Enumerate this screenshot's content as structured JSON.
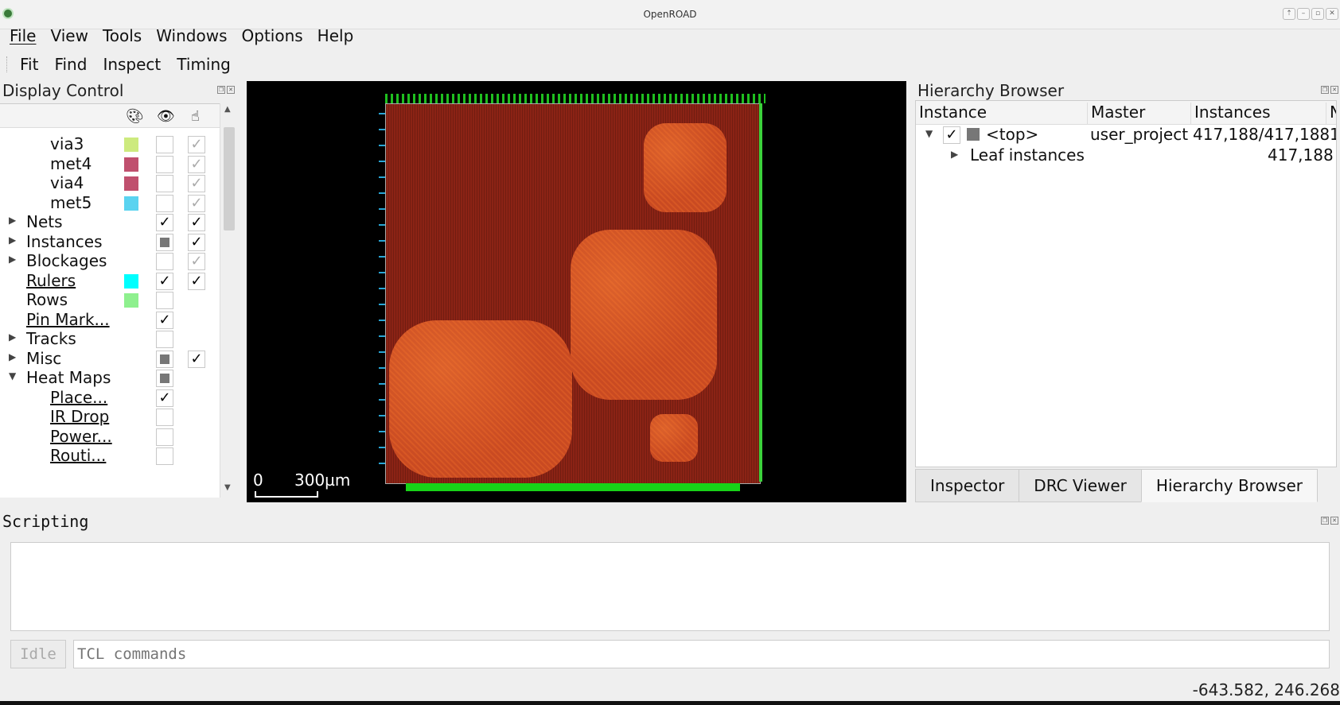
{
  "window": {
    "title": "OpenROAD"
  },
  "menu": [
    {
      "label": "File"
    },
    {
      "label": "View"
    },
    {
      "label": "Tools"
    },
    {
      "label": "Windows"
    },
    {
      "label": "Options"
    },
    {
      "label": "Help"
    }
  ],
  "toolbar": [
    {
      "label": "Fit"
    },
    {
      "label": "Find"
    },
    {
      "label": "Inspect"
    },
    {
      "label": "Timing"
    }
  ],
  "display_control": {
    "title": "Display Control",
    "column_icons": [
      "palette-icon",
      "eye-icon",
      "pointer-hand-icon"
    ],
    "rows": [
      {
        "label": "via3",
        "color": "#cdea7e",
        "visible": "off",
        "selectable": "dim"
      },
      {
        "label": "met4",
        "color": "#c0506e",
        "visible": "off",
        "selectable": "dim"
      },
      {
        "label": "via4",
        "color": "#c0506e",
        "visible": "off",
        "selectable": "dim"
      },
      {
        "label": "met5",
        "color": "#5ad3f0",
        "visible": "off",
        "selectable": "dim"
      },
      {
        "label": "Nets",
        "expander": "collapsed",
        "visible": "on",
        "selectable": "on"
      },
      {
        "label": "Instances",
        "expander": "collapsed",
        "visible": "partial",
        "selectable": "on"
      },
      {
        "label": "Blockages",
        "expander": "collapsed",
        "visible": "off",
        "selectable": "dim"
      },
      {
        "label": "Rulers",
        "link": true,
        "color": "#00ffff",
        "visible": "on",
        "selectable": "on"
      },
      {
        "label": "Rows",
        "color": "#8ef08e",
        "visible": "off"
      },
      {
        "label": "Pin Mark...",
        "link": true,
        "visible": "on"
      },
      {
        "label": "Tracks",
        "expander": "collapsed",
        "visible": "off"
      },
      {
        "label": "Misc",
        "expander": "collapsed",
        "visible": "partial",
        "selectable": "on"
      },
      {
        "label": "Heat Maps",
        "expander": "expanded",
        "visible": "partial"
      },
      {
        "label": "Place...",
        "link": true,
        "child": true,
        "visible": "on"
      },
      {
        "label": "IR Drop",
        "link": true,
        "child": true,
        "visible": "off"
      },
      {
        "label": "Power...",
        "link": true,
        "child": true,
        "visible": "off"
      },
      {
        "label": "Routi...",
        "link": true,
        "child": true,
        "visible": "off"
      }
    ]
  },
  "viewer": {
    "scale_zero": "0",
    "scale_label": "300µm"
  },
  "hierarchy": {
    "title": "Hierarchy Browser",
    "columns": [
      "Instance",
      "Master",
      "Instances",
      "N"
    ],
    "rows": [
      {
        "instance": "<top>",
        "master": "user_project",
        "instances": "417,188/417,188",
        "extra": "1"
      },
      {
        "instance": "Leaf instances",
        "master": "",
        "instances": "417,188"
      }
    ],
    "tabs": [
      {
        "label": "Inspector"
      },
      {
        "label": "DRC Viewer"
      },
      {
        "label": "Hierarchy Browser",
        "active": true
      }
    ]
  },
  "scripting": {
    "title": "Scripting",
    "status": "Idle",
    "placeholder": "TCL commands"
  },
  "status_coords": "-643.582, 246.268"
}
